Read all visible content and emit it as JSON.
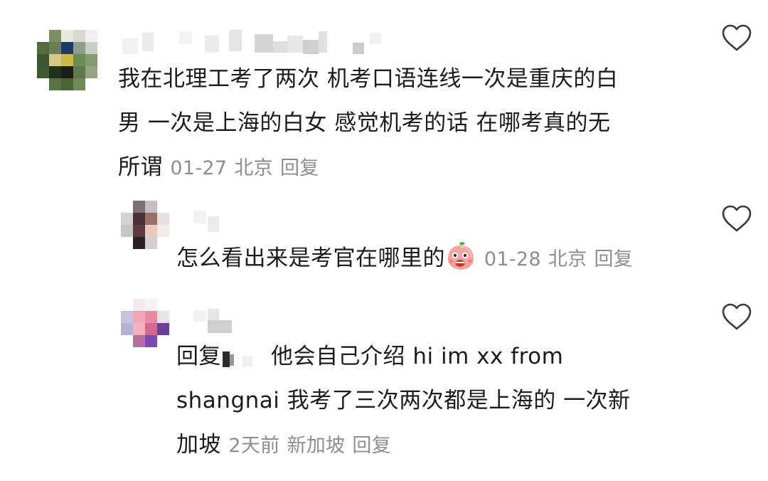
{
  "comments": [
    {
      "text": "我在北理工考了两次 机考口语连线一次是重庆的白男 一次是上海的白女 感觉机考的话 在哪考真的无所谓",
      "line1": "我在北理工考了两次 机考口语连线一次是重庆的白",
      "line2": "男 一次是上海的白女 感觉机考的话 在哪考真的无",
      "line3": "所谓",
      "date": "01-27",
      "location": "北京",
      "reply_label": "回复",
      "avatar_icon": "pixelated-avatar-icon",
      "like_icon": "heart-outline-icon"
    },
    {
      "text": "怎么看出来是考官在哪里的",
      "emoji": "surprised-peach-emoji-icon",
      "date": "01-28",
      "location": "北京",
      "reply_label": "回复",
      "avatar_icon": "pixelated-avatar-icon",
      "like_icon": "heart-outline-icon"
    },
    {
      "reply_prefix": "回复",
      "line1_rest": "他会自己介绍 hi im xx from",
      "line2": "shangnai 我考了三次两次都是上海的 一次新",
      "line3": "加坡",
      "date": "2天前",
      "location": "新加坡",
      "reply_label": "回复",
      "avatar_icon": "pixelated-avatar-icon",
      "like_icon": "heart-outline-icon"
    }
  ],
  "colors": {
    "text": "#1c1c1c",
    "meta": "#8e8e8e",
    "icon": "#3a3a3a"
  }
}
